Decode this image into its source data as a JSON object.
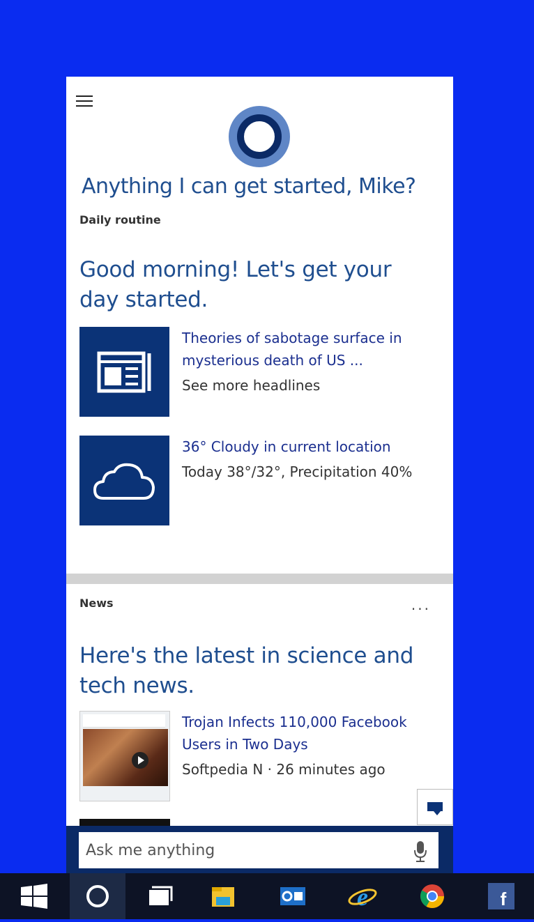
{
  "cortana": {
    "greeting": "Anything I can get started, Mike?",
    "daily_routine": {
      "label": "Daily routine",
      "heading": "Good morning! Let's get your day started.",
      "news_card": {
        "headline": "Theories of sabotage surface in mysterious death of US ...",
        "more": "See more headlines",
        "icon": "newspaper-icon"
      },
      "weather_card": {
        "summary": "36° Cloudy in current location",
        "detail": "Today 38°/32°, Precipitation 40%",
        "icon": "cloud-icon"
      }
    },
    "news": {
      "label": "News",
      "menu": "...",
      "heading": "Here's the latest in science and tech news.",
      "article": {
        "title": "Trojan Infects 110,000 Facebook Users in Two Days",
        "source": "Softpedia N · 26 minutes ago"
      }
    }
  },
  "search": {
    "placeholder": "Ask me anything"
  },
  "taskbar": {
    "items": [
      "start-icon",
      "cortana-icon",
      "task-view-icon",
      "file-explorer-icon",
      "outlook-icon",
      "internet-explorer-icon",
      "chrome-icon",
      "facebook-icon"
    ]
  },
  "colors": {
    "desktop": "#0a2cf0",
    "accent": "#0b3377",
    "heading": "#1f4e8f",
    "link": "#1b2f8f",
    "taskbar": "#0d1325"
  }
}
